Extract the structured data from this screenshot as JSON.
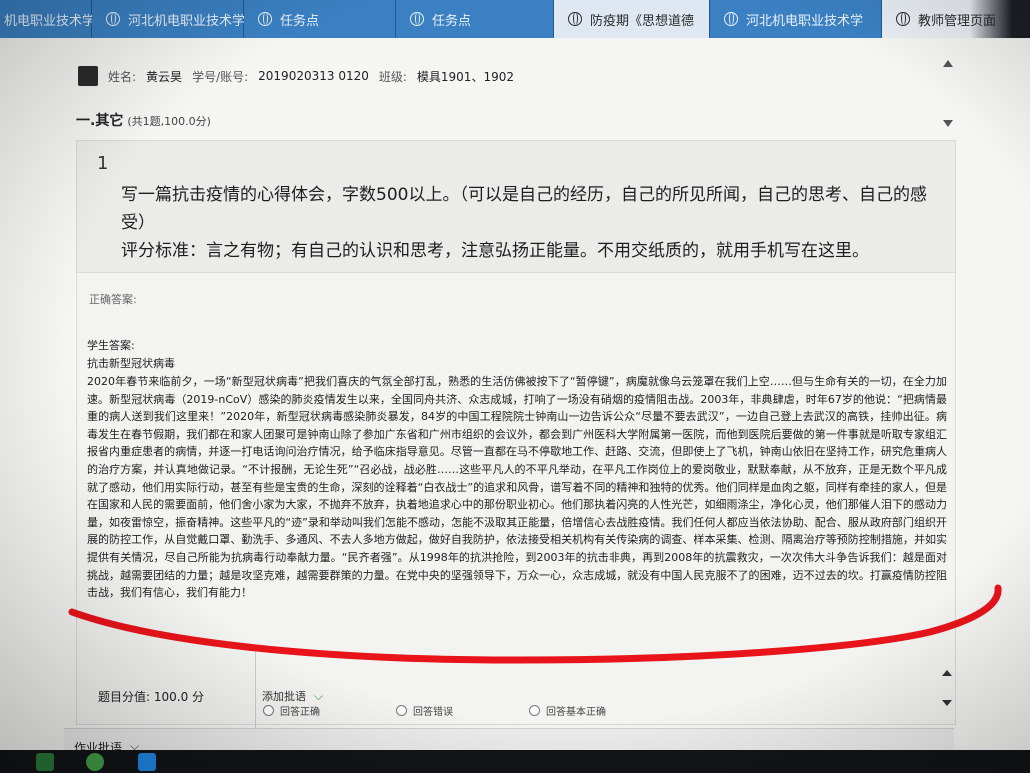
{
  "browser": {
    "tabs": [
      {
        "label": "机电职业技术学",
        "active": false
      },
      {
        "label": "河北机电职业技术学",
        "active": false
      },
      {
        "label": "任务点",
        "active": false
      },
      {
        "label": "任务点",
        "active": false
      },
      {
        "label": "防疫期《思想道德",
        "active": true
      },
      {
        "label": "河北机电职业技术学",
        "active": false
      },
      {
        "label": "教师管理页面",
        "active": false
      }
    ],
    "close_glyph": "✕"
  },
  "user": {
    "name_label": "姓名:",
    "name": "黄云昊",
    "id_label": "学号/账号:",
    "id": "2019020313 0120",
    "class_label": "班级:",
    "class": "模具1901、1902"
  },
  "section": {
    "title": "一.其它",
    "meta": "(共1题,100.0分)"
  },
  "question": {
    "number": "1",
    "text": "写一篇抗击疫情的心得体会，字数500以上。（可以是自己的经历，自己的所见所闻，自己的思考、自己的感受）",
    "criteria": "评分标准：言之有物；有自己的认识和思考，注意弘扬正能量。不用交纸质的，就用手机写在这里。"
  },
  "labels": {
    "correct_answer": "正确答案:",
    "student_answer": "学生答案:",
    "essay_title": "抗击新型冠状病毒"
  },
  "essay": "2020年春节来临前夕，一场“新型冠状病毒”把我们喜庆的气氛全部打乱，熟悉的生活仿佛被按下了“暂停键”，病魔就像乌云笼罩在我们上空……但与生命有关的一切，在全力加速。新型冠状病毒（2019-nCoV）感染的肺炎疫情发生以来，全国同舟共济、众志成城，打响了一场没有硝烟的疫情阻击战。2003年，非典肆虐，时年67岁的他说：“把病情最重的病人送到我们这里来！”2020年，新型冠状病毒感染肺炎暴发，84岁的中国工程院院士钟南山一边告诉公众“尽量不要去武汉”，一边自己登上去武汉的高铁，挂帅出征。病毒发生在春节假期，我们都在和家人团聚可是钟南山除了参加广东省和广州市组织的会议外，都会到广州医科大学附属第一医院，而他到医院后要做的第一件事就是听取专家组汇报省内重症患者的病情，并逐一打电话询问治疗情况，给予临床指导意见。尽管一直都在马不停歇地工作、赶路、交流，但即使上了飞机，钟南山依旧在坚持工作，研究危重病人的治疗方案，并认真地做记录。“不计报酬，无论生死”“召必战，战必胜……这些平凡人的不平凡举动，在平凡工作岗位上的爱岗敬业，默默奉献，从不放弃，正是无数个平凡成就了感动，他们用实际行动，甚至有些是宝贵的生命，深刻的诠释着“白衣战士”的追求和风骨，谱写着不同的精神和独特的优秀。他们同样是血肉之躯，同样有牵挂的家人，但是在国家和人民的需要面前，他们舍小家为大家，不抛弃不放弃，执着地追求心中的那份职业初心。他们那执着闪亮的人性光芒，如细雨涤尘，净化心灵，他们那催人泪下的感动力量，如夜雷惊空，振奋精神。这些平凡的“迹”录和举动叫我们怎能不感动，怎能不汲取其正能量，倍增信心去战胜疫情。我们任何人都应当依法协助、配合、服从政府部门组织开展的防控工作，从自觉戴口罩、勤洗手、多通风、不去人多地方做起，做好自我防护，依法接受相关机构有关传染病的调查、样本采集、检测、隔离治疗等预防控制措施，并如实提供有关情况，尽自己所能为抗病毒行动奉献力量。“民齐者强”。从1998年的抗洪抢险，到2003年的抗击非典，再到2008年的抗震救灾，一次次伟大斗争告诉我们：越是面对挑战，越需要团结的力量；越是攻坚克难，越需要群策的力量。在党中央的坚强领导下，万众一心，众志成城，就没有中国人民克服不了的困难，迈不过去的坎。打赢疫情防控阻击战，我们有信心，我们有能力！",
  "grading": {
    "options": [
      "回答正确",
      "回答错误",
      "回答基本正确"
    ],
    "score_label": "题目分值:",
    "score": "100.0 分",
    "comment_label": "添加批语",
    "chevron": "⌵"
  },
  "footer": {
    "homework_comment": "作业批语",
    "chevron": "⌵"
  },
  "colors": {
    "annotation": "#e8141a",
    "tab_bar": "#2a6fb0"
  },
  "icons": [
    "globe-icon",
    "close-icon",
    "avatar",
    "chevron-down-icon"
  ]
}
